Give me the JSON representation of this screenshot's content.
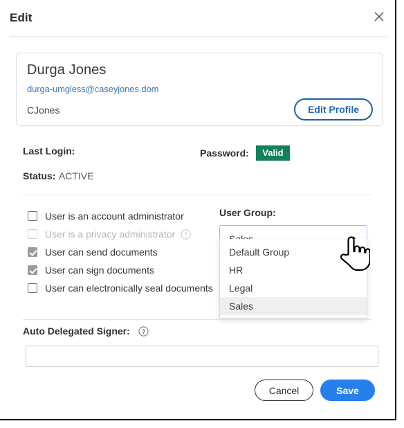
{
  "dialog": {
    "title": "Edit",
    "close_icon": "close-icon"
  },
  "profile": {
    "name": "Durga Jones",
    "email": "durga-umgless@caseyjones.dom",
    "username": "CJones",
    "edit_profile_label": "Edit Profile"
  },
  "meta": {
    "last_login_label": "Last Login:",
    "last_login_value": "",
    "password_label": "Password:",
    "password_badge": "Valid",
    "password_badge_color": "#12805c",
    "status_label": "Status:",
    "status_value": "ACTIVE"
  },
  "permissions": [
    {
      "label": "User is an account administrator",
      "checked": false,
      "disabled": false,
      "help": false
    },
    {
      "label": "User is a privacy administrator",
      "checked": false,
      "disabled": true,
      "help": true
    },
    {
      "label": "User can send documents",
      "checked": true,
      "disabled": false,
      "help": false
    },
    {
      "label": "User can sign documents",
      "checked": true,
      "disabled": false,
      "help": false
    },
    {
      "label": "User can electronically seal documents",
      "checked": false,
      "disabled": false,
      "help": false
    }
  ],
  "user_group": {
    "label": "User Group:",
    "selected": "Sales",
    "expanded": true,
    "caret_icon": "caret-up-icon",
    "options": [
      "Default Group",
      "HR",
      "Legal",
      "Sales"
    ]
  },
  "auto_delegated_signer": {
    "label": "Auto Delegated Signer:",
    "help_icon": "help-circle-icon",
    "value": "",
    "placeholder": ""
  },
  "footer": {
    "cancel_label": "Cancel",
    "save_label": "Save",
    "save_color": "#2680eb"
  },
  "cursor": {
    "icon": "pointing-hand-cursor"
  }
}
